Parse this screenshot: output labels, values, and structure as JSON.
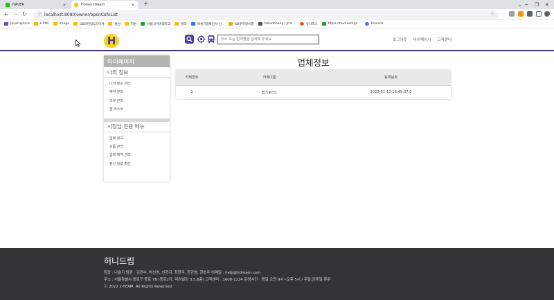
{
  "browser": {
    "tabs": [
      {
        "title": "NAVER",
        "color": "#1ec800",
        "active": false
      },
      {
        "title": "Honey Dream",
        "color": "#f2c200",
        "active": true
      }
    ],
    "new_tab": "+",
    "url": "localhost:8080/owner/openCafeList",
    "bookmarks": [
      {
        "label": "JavaCapture",
        "color": "#6a4aa5"
      },
      {
        "label": "HTML",
        "color": "#f2c200"
      },
      {
        "label": "image",
        "color": "#f2c200"
      },
      {
        "label": "3D프린팅&하이커",
        "color": "#f2c200"
      },
      {
        "label": "경성",
        "color": "#f2c200"
      },
      {
        "label": "학원",
        "color": "#f2c200"
      },
      {
        "label": "서울사이버대학교",
        "color": "#2b9a3a"
      },
      {
        "label": "필라",
        "color": "#f2c200"
      },
      {
        "label": "여성기업확인서 신...",
        "color": "#3a6fd8"
      },
      {
        "label": "KB푸하랑이를",
        "color": "#e0b000"
      },
      {
        "label": "tebodohang | Jirai...",
        "color": "#555555"
      },
      {
        "label": "유니텍스",
        "color": "#e05a1e"
      },
      {
        "label": "https://text-compa...",
        "color": "#2b9a3a"
      },
      {
        "label": "Discord",
        "color": "#5865f2"
      }
    ]
  },
  "header": {
    "logo_letter": "H",
    "search_placeholder": "주소 또는 업체명을 검색해 주세요",
    "links": [
      "로그아웃",
      "마이페이지",
      "고객센터"
    ],
    "accent_color": "#3a2f8a"
  },
  "sidebar": {
    "title": "마이페이지",
    "groups": [
      {
        "title": "나의 정보",
        "items": [
          "나의 정보 관리",
          "예약 관리",
          "리뷰 관리",
          "찜 리스트"
        ]
      },
      {
        "title": "사장님 전용 메뉴",
        "items": [
          "업체 정보",
          "상품 관리",
          "업체 예약 관리",
          "정산 정보 확인"
        ]
      }
    ]
  },
  "main": {
    "title": "업체정보",
    "table": {
      "headers": [
        "카페번호",
        "카페이름",
        "등록날짜"
      ],
      "rows": [
        [
          "1",
          "쉼스토리1",
          "2023-01-11 16:49:37.0"
        ]
      ]
    }
  },
  "footer": {
    "brand": "허니드림",
    "line1": "팀장 : 나슬기     팀원 : 김현수, 박선영, 신현지, 최현주, 한규영, 한승주     이메일 : help@hdream.com",
    "line2": "주소 : 서울특별시 종로구 종로 78 (종로2가, 미려빌딩 3,5,6층)     고객센터 : 1600-1234     운영시간 : 평일 오전 9시~오후 5시 / 주말,공휴일 휴무",
    "line3": "ⓒ 2022 2-TEAM. All Rights Reserved."
  }
}
